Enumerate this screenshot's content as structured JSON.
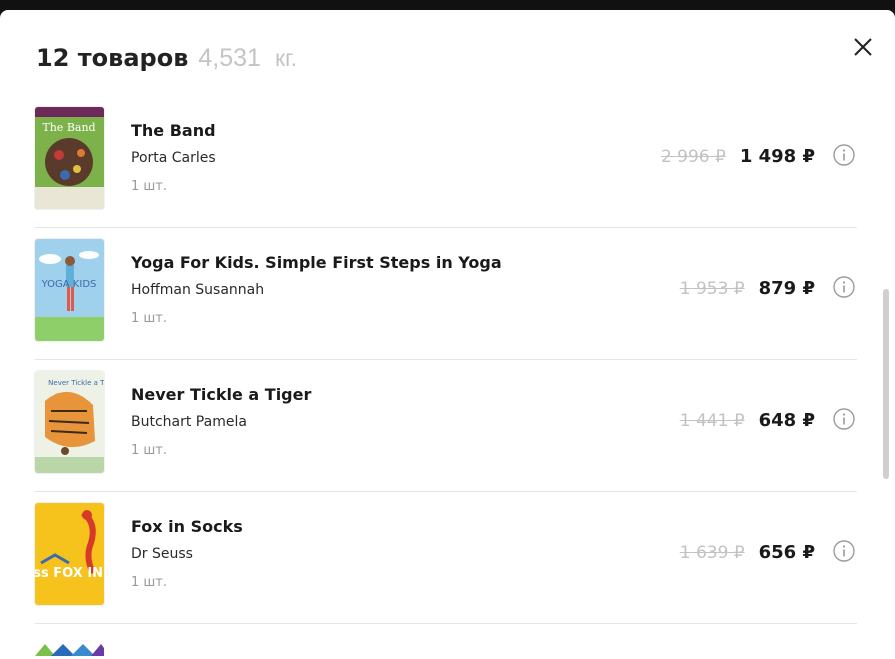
{
  "header": {
    "count_text": "12 товаров",
    "weight_value": "4,531",
    "weight_unit": "кг."
  },
  "icons": {
    "close": "close-icon",
    "info": "info-icon"
  },
  "items": [
    {
      "title": "The Band",
      "author": "Porta Carles",
      "qty": "1 шт.",
      "old_price": "2 996 ₽",
      "price": "1 498 ₽",
      "cover_text": "The Band"
    },
    {
      "title": "Yoga For Kids. Simple First Steps in Yoga",
      "author": "Hoffman Susannah",
      "qty": "1 шт.",
      "old_price": "1 953 ₽",
      "price": "879 ₽",
      "cover_text": "YOGA KIDS"
    },
    {
      "title": "Never Tickle a Tiger",
      "author": "Butchart Pamela",
      "qty": "1 шт.",
      "old_price": "1 441 ₽",
      "price": "648 ₽",
      "cover_text": "Never Tickle a Tiger"
    },
    {
      "title": "Fox in Socks",
      "author": "Dr Seuss",
      "qty": "1 шт.",
      "old_price": "1 639 ₽",
      "price": "656 ₽",
      "cover_text": "Dr. Seuss FOX IN SOCKS"
    }
  ],
  "colors": {
    "text_primary": "#1a1a1a",
    "text_muted": "#9a9a9a",
    "old_price": "#c2c2c2",
    "divider": "#e6e6e6"
  }
}
